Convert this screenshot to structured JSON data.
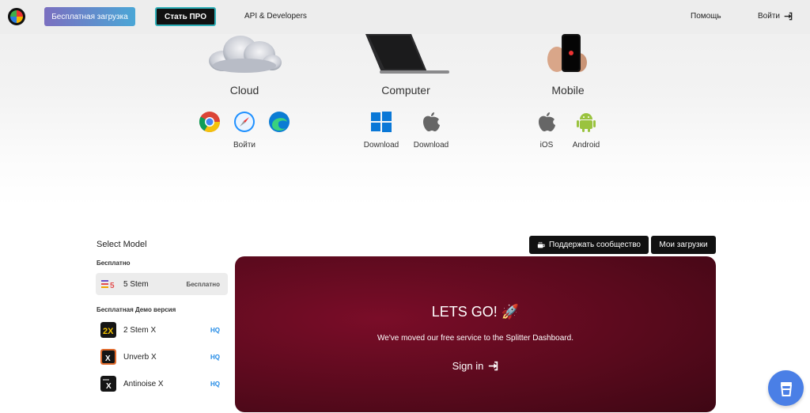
{
  "nav": {
    "free_download": "Бесплатная загрузка",
    "go_pro": "Стать ПРО",
    "api": "API & Developers",
    "help": "Помощь",
    "login": "Войти",
    "login_icon": "sign-in-icon"
  },
  "platforms": {
    "cloud": {
      "title": "Cloud",
      "icons": [
        "chrome-icon",
        "safari-icon",
        "edge-icon"
      ],
      "label": "Войти"
    },
    "computer": {
      "title": "Computer",
      "items": [
        {
          "icon": "windows-icon",
          "label": "Download"
        },
        {
          "icon": "apple-icon",
          "label": "Download"
        }
      ]
    },
    "mobile": {
      "title": "Mobile",
      "items": [
        {
          "icon": "apple-icon",
          "label": "iOS"
        },
        {
          "icon": "android-icon",
          "label": "Android"
        }
      ]
    }
  },
  "models": {
    "title": "Select Model",
    "free_group": "Бесплатно",
    "demo_group": "Бесплатная Демо версия",
    "free_items": [
      {
        "name": "5 Stem",
        "tag": "Бесплатно",
        "icon": "five-stem-icon",
        "icon_text": "5"
      }
    ],
    "demo_items": [
      {
        "name": "2 Stem X",
        "tag": "HQ",
        "icon": "two-stem-x-icon",
        "icon_text": "2X"
      },
      {
        "name": "Unverb X",
        "tag": "HQ",
        "icon": "unverb-x-icon",
        "icon_text": "X"
      },
      {
        "name": "Antinoise X",
        "tag": "HQ",
        "icon": "antinoise-x-icon",
        "icon_text": "X"
      }
    ]
  },
  "actions": {
    "support": "Поддержать сообщество",
    "support_icon": "coffee-icon",
    "downloads": "Мои загрузки"
  },
  "promo": {
    "title": "LETS GO! 🚀",
    "subtitle": "We've moved our free service to the Splitter Dashboard.",
    "signin": "Sign in",
    "signin_icon": "sign-in-icon"
  },
  "fab_icon": "cup-icon",
  "colors": {
    "promo_bg": "#5a0a1d",
    "hq": "#1e88e5",
    "fab": "#4a7fe6",
    "pro_border": "#2fb0b8"
  }
}
